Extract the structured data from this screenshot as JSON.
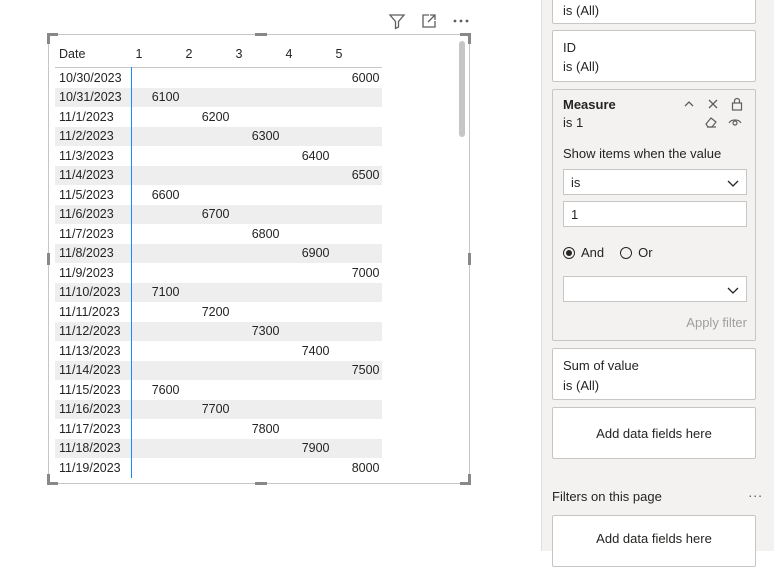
{
  "visual": {
    "toolbar": [
      "filter-icon",
      "focus-mode-icon",
      "more-options-icon"
    ],
    "headers": [
      "Date",
      "1",
      "2",
      "3",
      "4",
      "5"
    ],
    "rows": [
      {
        "date": "10/30/2023",
        "col": 5,
        "value": "6000"
      },
      {
        "date": "10/31/2023",
        "col": 1,
        "value": "6100"
      },
      {
        "date": "11/1/2023",
        "col": 2,
        "value": "6200"
      },
      {
        "date": "11/2/2023",
        "col": 3,
        "value": "6300"
      },
      {
        "date": "11/3/2023",
        "col": 4,
        "value": "6400"
      },
      {
        "date": "11/4/2023",
        "col": 5,
        "value": "6500"
      },
      {
        "date": "11/5/2023",
        "col": 1,
        "value": "6600"
      },
      {
        "date": "11/6/2023",
        "col": 2,
        "value": "6700"
      },
      {
        "date": "11/7/2023",
        "col": 3,
        "value": "6800"
      },
      {
        "date": "11/8/2023",
        "col": 4,
        "value": "6900"
      },
      {
        "date": "11/9/2023",
        "col": 5,
        "value": "7000"
      },
      {
        "date": "11/10/2023",
        "col": 1,
        "value": "7100"
      },
      {
        "date": "11/11/2023",
        "col": 2,
        "value": "7200"
      },
      {
        "date": "11/12/2023",
        "col": 3,
        "value": "7300"
      },
      {
        "date": "11/13/2023",
        "col": 4,
        "value": "7400"
      },
      {
        "date": "11/14/2023",
        "col": 5,
        "value": "7500"
      },
      {
        "date": "11/15/2023",
        "col": 1,
        "value": "7600"
      },
      {
        "date": "11/16/2023",
        "col": 2,
        "value": "7700"
      },
      {
        "date": "11/17/2023",
        "col": 3,
        "value": "7800"
      },
      {
        "date": "11/18/2023",
        "col": 4,
        "value": "7900"
      },
      {
        "date": "11/19/2023",
        "col": 5,
        "value": "8000"
      }
    ]
  },
  "filters": {
    "top_card": {
      "sub": "is (All)"
    },
    "id_card": {
      "title": "ID",
      "sub": "is (All)"
    },
    "measure_card": {
      "title": "Measure",
      "sub": "is 1",
      "show_items_label": "Show items when the value",
      "operator": "is",
      "value": "1",
      "and_label": "And",
      "or_label": "Or",
      "second_operator": "",
      "apply_label": "Apply filter"
    },
    "sum_card": {
      "title": "Sum of value",
      "sub": "is (All)"
    },
    "add_fields_label": "Add data fields here",
    "page_section_title": "Filters on this page",
    "page_section_more": "...",
    "page_add_fields_label": "Add data fields here"
  },
  "colors": {
    "accent": "#118dff",
    "row_alt": "#eeeeee"
  }
}
